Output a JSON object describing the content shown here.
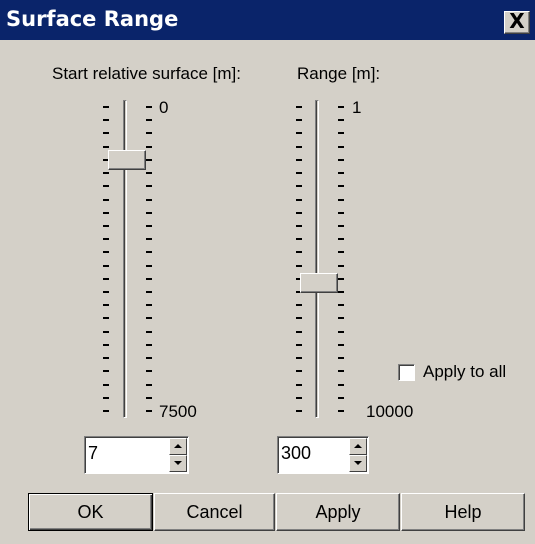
{
  "window": {
    "title": "Surface Range",
    "close_glyph": "X"
  },
  "start_surface": {
    "label": "Start relative surface [m]:",
    "min_label": "0",
    "max_label": "7500",
    "value": "7"
  },
  "range": {
    "label": "Range [m]:",
    "min_label": "1",
    "max_label": "10000",
    "value": "300"
  },
  "apply_to_all": {
    "label": "Apply to all",
    "checked": false
  },
  "buttons": {
    "ok": "OK",
    "cancel": "Cancel",
    "apply": "Apply",
    "help": "Help"
  },
  "icons": {
    "close": "close-icon",
    "spin_up": "spin-up-arrow-icon",
    "spin_down": "spin-down-arrow-icon"
  },
  "colors": {
    "titlebar": "#0a246a",
    "face": "#d4d0c8"
  }
}
